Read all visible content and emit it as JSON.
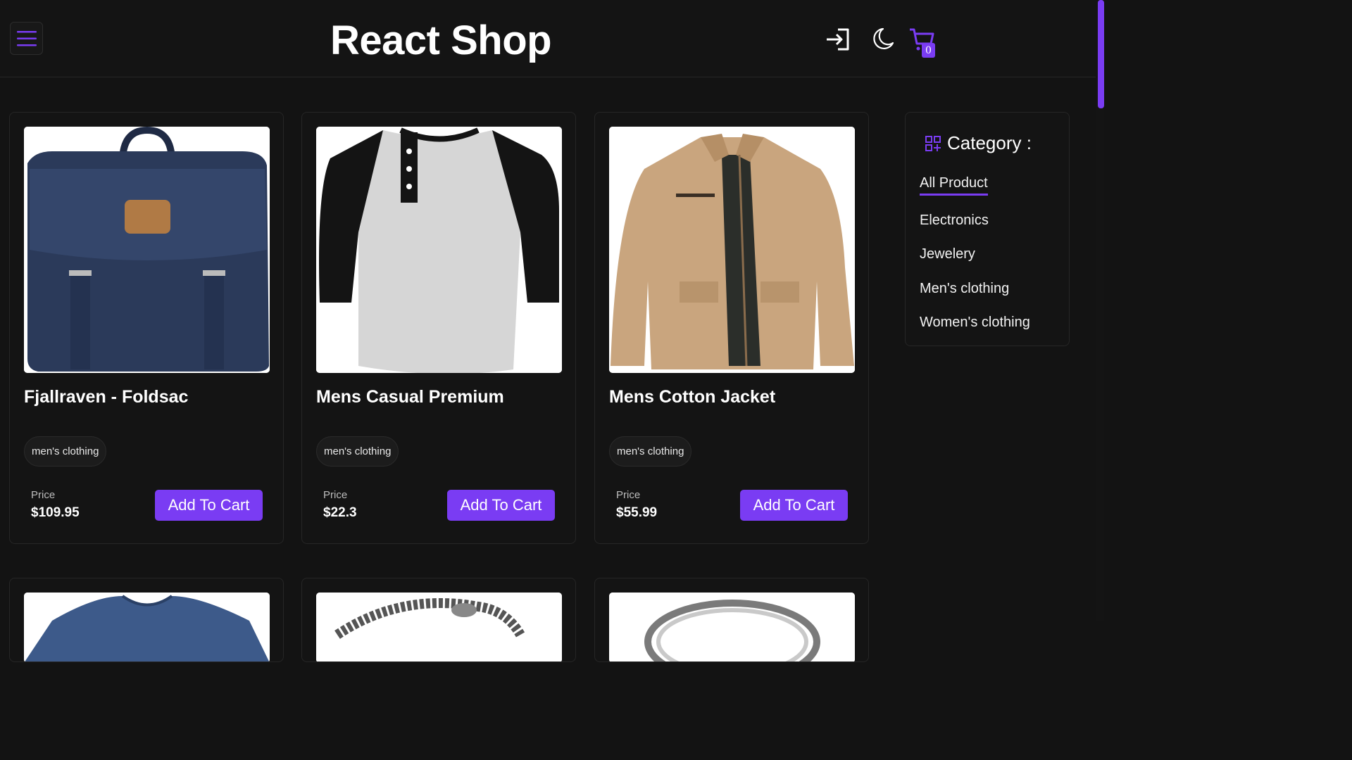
{
  "header": {
    "title": "React Shop",
    "cart_count": "0"
  },
  "products": [
    {
      "title": "Fjallraven - Foldsac",
      "category": "men's clothing",
      "price_label": "Price",
      "price": "$109.95",
      "button": "Add To Cart"
    },
    {
      "title": "Mens Casual Premium",
      "category": "men's clothing",
      "price_label": "Price",
      "price": "$22.3",
      "button": "Add To Cart"
    },
    {
      "title": "Mens Cotton Jacket",
      "category": "men's clothing",
      "price_label": "Price",
      "price": "$55.99",
      "button": "Add To Cart"
    }
  ],
  "sidebar": {
    "title": "Category :",
    "items": [
      {
        "label": "All Product",
        "active": true
      },
      {
        "label": "Electronics"
      },
      {
        "label": "Jewelery"
      },
      {
        "label": "Men's clothing"
      },
      {
        "label": "Women's clothing"
      }
    ]
  },
  "icons": {
    "menu": "hamburger-menu-icon",
    "login": "login-icon",
    "theme": "moon-icon",
    "cart": "cart-icon",
    "category": "grid-plus-icon"
  },
  "colors": {
    "accent": "#7a3cf3",
    "background": "#131313",
    "text": "#ffffff"
  }
}
